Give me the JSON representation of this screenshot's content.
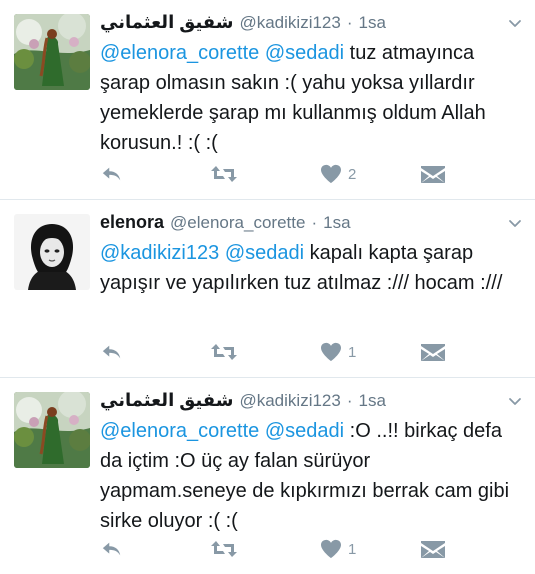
{
  "tweets": [
    {
      "name": "شفيق العثماني",
      "handle": "@kadikizi123",
      "dot": "·",
      "time": "1sa",
      "mentions": [
        "@elenora_corette",
        "@sedadi"
      ],
      "text": "tuz atmayınca şarap olmasın sakın :( yahu yoksa yıllardır yemeklerde şarap mı kullanmış oldum Allah korusun.! :( :(",
      "like_count": "2"
    },
    {
      "name": "elenora",
      "handle": "@elenora_corette",
      "dot": "·",
      "time": "1sa",
      "mentions": [
        "@kadikizi123",
        "@sedadi"
      ],
      "text": "kapalı kapta şarap yapışır ve yapılırken tuz atılmaz :/// hocam :///",
      "like_count": "1"
    },
    {
      "name": "شفيق العثماني",
      "handle": "@kadikizi123",
      "dot": "·",
      "time": "1sa",
      "mentions": [
        "@elenora_corette",
        "@sedadi"
      ],
      "text": ":O ..!! birkaç defa da içtim :O üç ay falan sürüyor yapmam.seneye de kıpkırmızı berrak cam gibi sirke oluyor :( :(",
      "like_count": "1"
    }
  ],
  "icons": {
    "reply": "reply-icon",
    "retweet": "retweet-icon",
    "like": "heart-icon",
    "dm": "envelope-icon",
    "caret": "chevron-down-icon"
  },
  "colors": {
    "mention": "#1b95e0",
    "muted": "#657786",
    "icon": "#8899a6",
    "divider": "#e1e8ed"
  }
}
